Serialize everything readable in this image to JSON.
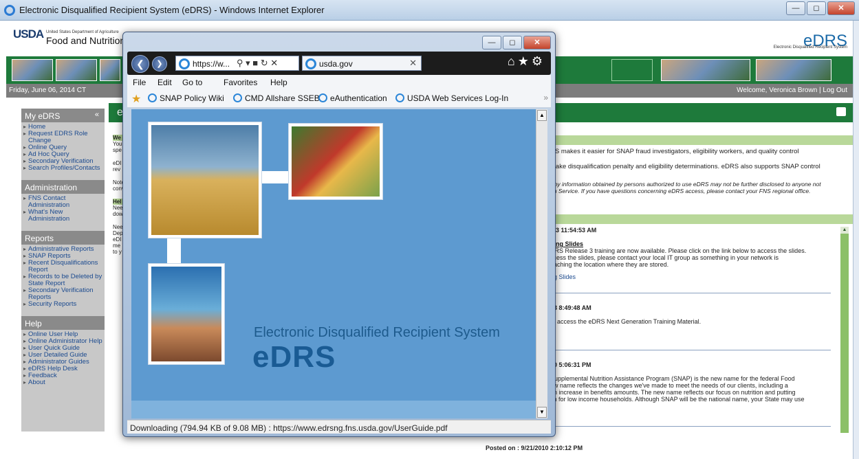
{
  "outer_window": {
    "title": "Electronic Disqualified Recipient System (eDRS) - Windows Internet Explorer"
  },
  "site": {
    "agency_logo": "USDA",
    "department": "United States Department of Agriculture",
    "agency": "Food and Nutrition",
    "brand": "eDRS",
    "brand_sub": "Electronic Disqualified Recipient System",
    "date": "Friday, June 06, 2014 CT",
    "welcome": "Welcome, Veronica Brown | Log Out"
  },
  "sidebar": {
    "sections": [
      {
        "title": "My eDRS",
        "collapse": "«",
        "items": [
          "Home",
          "Request EDRS Role Change",
          "Online Query",
          "Ad Hoc Query",
          "Secondary Verification",
          "Search Profiles/Contacts"
        ]
      },
      {
        "title": "Administration",
        "items": [
          "FNS Contact Administration",
          "What's New Administration"
        ]
      },
      {
        "title": "Reports",
        "items": [
          "Administrative Reports",
          "SNAP Reports",
          "Recent Disqualifications Report",
          "Records to be Deleted by State Report",
          "Secondary Verification Reports",
          "Security Reports"
        ]
      },
      {
        "title": "Help",
        "items": [
          "Online User Help",
          "Online Administrator Help",
          "User Quick Guide",
          "User Detailed Guide",
          "Administrator Guides",
          "eDRS Help Desk",
          "Feedback",
          "About"
        ]
      }
    ]
  },
  "main": {
    "header_letter": "e",
    "left_fragments": [
      "We",
      "You",
      "spe",
      "eDI",
      "rev",
      "Note",
      "conv",
      "Hel",
      "Nee",
      "dow",
      "Nee",
      "Dep",
      "eDI",
      "me",
      "to y"
    ],
    "intro": [
      "RS makes it easier for SNAP fraud investigators, eligibility workers, and quality control",
      "make disqualification penalty and eligibility determinations. eDRS also supports SNAP control",
      "Any information obtained by persons authorized to use eDRS may not be further disclosed to anyone not",
      "on Service. If you have questions concerning eDRS access, please contact your FNS regional office."
    ],
    "news": [
      {
        "time": ")13 11:54:53 AM",
        "title": "ning Slides",
        "body": [
          "DRS Release 3 training are now available. Please click on the link below to access the slides.",
          "ccess the slides, please contact your local IT group as something in your network is",
          "eaching the location where they are stored."
        ],
        "link": "ng Slides"
      },
      {
        "time": "13 8:49:48 AM",
        "body": [
          "to access the eDRS Next Generation Training Material."
        ],
        "link": "g"
      },
      {
        "time": "10 5:06:31 PM",
        "body": [
          "Supplemental Nutrition Assistance Program (SNAP) is the new name for the federal Food",
          "ew name reflects the changes we've made to meet the needs of our clients, including a",
          "an increase in benefits amounts. The new name reflects our focus on nutrition and putting",
          "ch for low income households. Although SNAP will be the national name, your State may use"
        ]
      }
    ],
    "posted": "Posted on : 9/21/2010 2:10:12 PM"
  },
  "popup": {
    "address": "https://w...",
    "tab_label": "usda.gov",
    "menu": [
      "File",
      "Edit",
      "Go to",
      "Favorites",
      "Help"
    ],
    "favorites": [
      "SNAP Policy Wiki",
      "CMD Allshare SSEB",
      "eAuthentication",
      "USDA Web Services Log-In"
    ],
    "brand_title": "Electronic Disqualified Recipient System",
    "brand_logo": "eDRS",
    "status": "Downloading (794.94 KB of 9.08 MB) : https://www.edrsng.fns.usda.gov/UserGuide.pdf"
  }
}
